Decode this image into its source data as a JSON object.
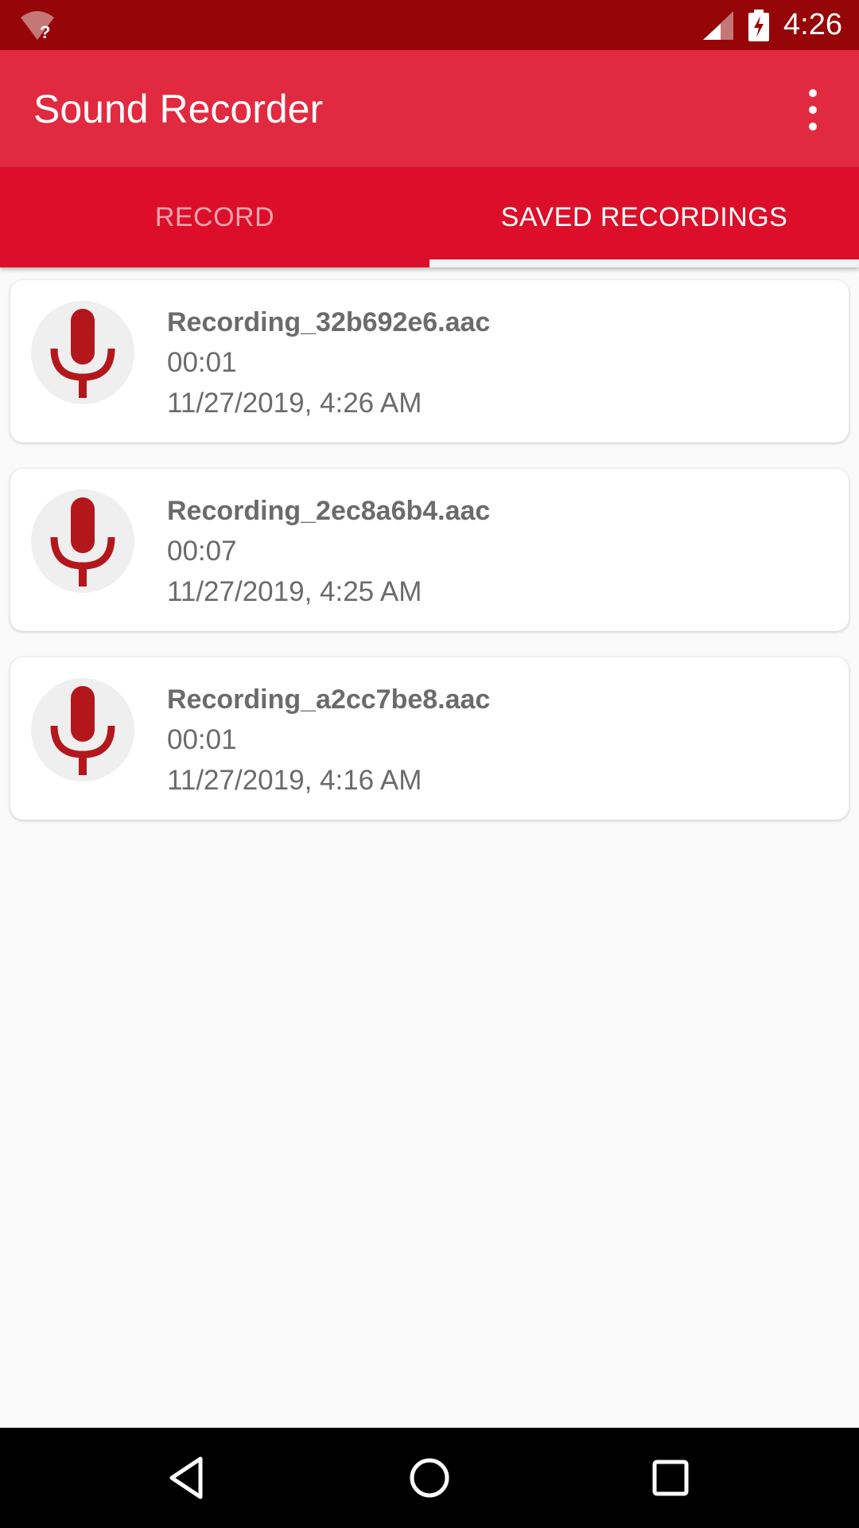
{
  "status_bar": {
    "time": "4:26",
    "icons": [
      "wifi-unknown-icon",
      "cell-signal-icon",
      "battery-charging-icon"
    ]
  },
  "app_bar": {
    "title": "Sound Recorder",
    "menu_icon": "overflow-menu-icon"
  },
  "tabs": [
    {
      "label": "RECORD",
      "selected": false
    },
    {
      "label": "SAVED RECORDINGS",
      "selected": true
    }
  ],
  "recordings": [
    {
      "name": "Recording_32b692e6.aac",
      "duration": "00:01",
      "date": "11/27/2019, 4:26 AM",
      "icon": "microphone-icon"
    },
    {
      "name": "Recording_2ec8a6b4.aac",
      "duration": "00:07",
      "date": "11/27/2019, 4:25 AM",
      "icon": "microphone-icon"
    },
    {
      "name": "Recording_a2cc7be8.aac",
      "duration": "00:01",
      "date": "11/27/2019, 4:16 AM",
      "icon": "microphone-icon"
    }
  ],
  "nav_bar": {
    "icons": [
      "back-icon",
      "home-icon",
      "recents-icon"
    ]
  },
  "colors": {
    "status_bar": "#960609",
    "app_bar": "#e12a40",
    "tabs": "#dc0e29",
    "mic": "#b3171c"
  }
}
